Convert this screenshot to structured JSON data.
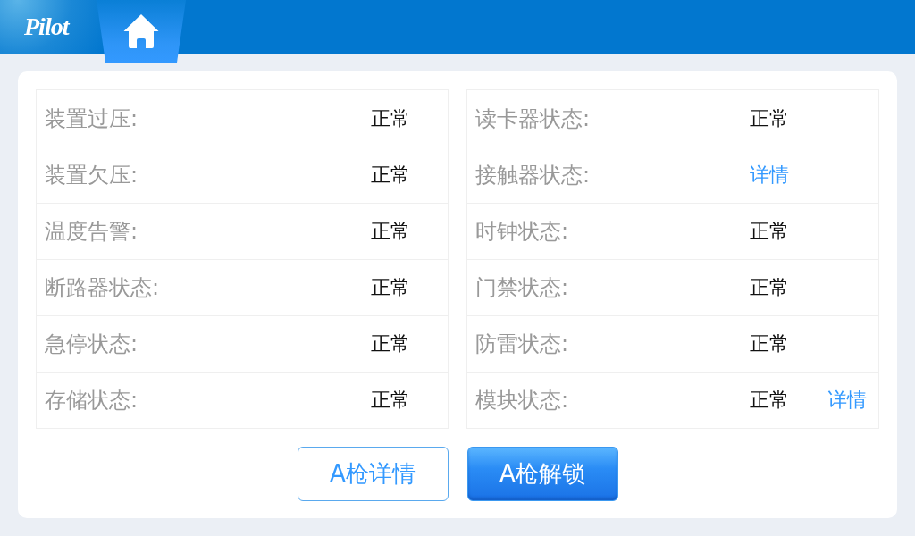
{
  "header": {
    "logo": "Pilot"
  },
  "left_table": {
    "rows": [
      {
        "label": "装置过压:",
        "value": {
          "kind": "text",
          "text": "正常"
        }
      },
      {
        "label": "装置欠压:",
        "value": {
          "kind": "text",
          "text": "正常"
        }
      },
      {
        "label": "温度告警:",
        "value": {
          "kind": "text",
          "text": "正常"
        }
      },
      {
        "label": "断路器状态:",
        "value": {
          "kind": "text",
          "text": "正常"
        }
      },
      {
        "label": "急停状态:",
        "value": {
          "kind": "text",
          "text": "正常"
        }
      },
      {
        "label": "存储状态:",
        "value": {
          "kind": "text",
          "text": "正常"
        }
      }
    ]
  },
  "right_table": {
    "rows": [
      {
        "label": "读卡器状态:",
        "value": {
          "kind": "text",
          "text": "正常"
        }
      },
      {
        "label": "接触器状态:",
        "value": {
          "kind": "link",
          "text": "详情"
        }
      },
      {
        "label": "时钟状态:",
        "value": {
          "kind": "text",
          "text": "正常"
        }
      },
      {
        "label": "门禁状态:",
        "value": {
          "kind": "text",
          "text": "正常"
        }
      },
      {
        "label": "防雷状态:",
        "value": {
          "kind": "text",
          "text": "正常"
        }
      },
      {
        "label": "模块状态:",
        "value": {
          "kind": "text",
          "text": "正常"
        },
        "extra": {
          "kind": "link",
          "text": "详情"
        }
      }
    ]
  },
  "buttons": [
    {
      "label": "A枪详情",
      "kind": "outline"
    },
    {
      "label": "A枪解锁",
      "kind": "primary"
    }
  ]
}
